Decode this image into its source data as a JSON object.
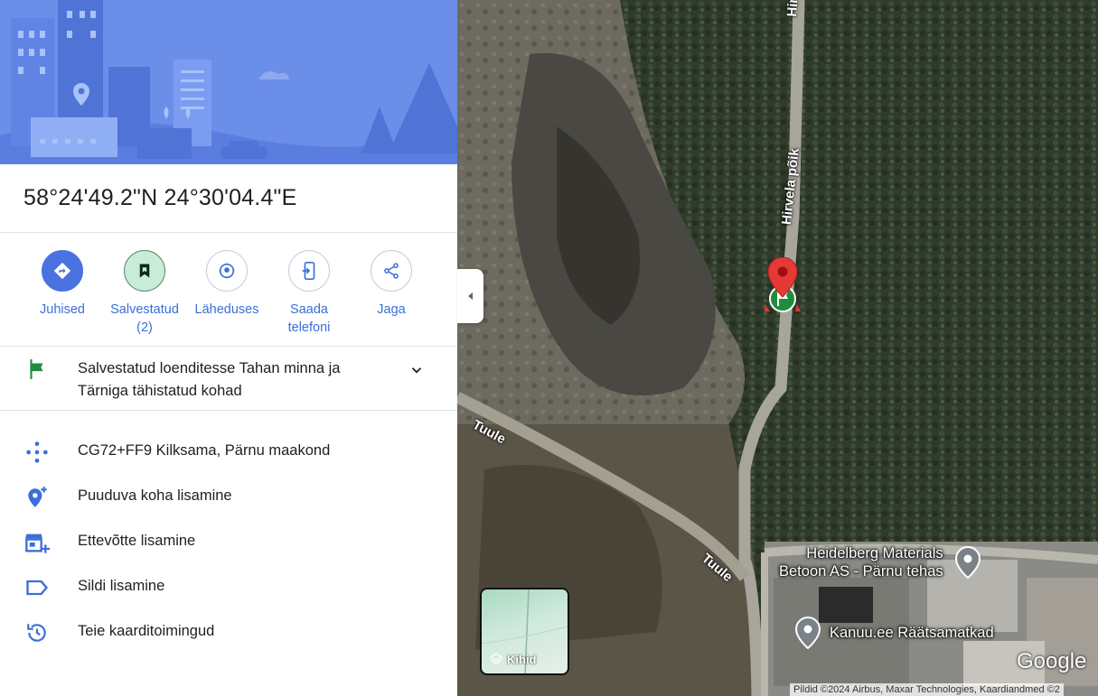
{
  "place": {
    "coordinates": "58°24'49.2\"N 24°30'04.4\"E"
  },
  "actions": [
    {
      "label": "Juhised",
      "icon": "directions-icon"
    },
    {
      "label": "Salvestatud (2)",
      "icon": "bookmark-icon"
    },
    {
      "label": "Läheduses",
      "icon": "nearby-icon"
    },
    {
      "label": "Saada telefoni",
      "icon": "send-to-phone-icon"
    },
    {
      "label": "Jaga",
      "icon": "share-icon"
    }
  ],
  "saved_lists": {
    "text": "Salvestatud loenditesse Tahan minna ja Tärniga tähistatud kohad",
    "icon": "flag-icon"
  },
  "details": [
    {
      "label": "CG72+FF9 Kilksama, Pärnu maakond",
      "icon": "plus-code-icon"
    },
    {
      "label": "Puuduva koha lisamine",
      "icon": "add-place-icon"
    },
    {
      "label": "Ettevõtte lisamine",
      "icon": "add-business-icon"
    },
    {
      "label": "Sildi lisamine",
      "icon": "label-icon"
    },
    {
      "label": "Teie kaarditoimingud",
      "icon": "history-icon"
    }
  ],
  "map": {
    "roads": [
      "Hirvela",
      "Hirvela põik",
      "Tuule",
      "Tuule"
    ],
    "pois": [
      {
        "name_line1": "Heidelberg Materials",
        "name_line2": "Betoon AS - Pärnu tehas"
      },
      {
        "name_line1": "Kanuu.ee Räätsamatkad"
      }
    ],
    "layers_label": "Kihid",
    "logo": "Google",
    "attribution": "Pildid ©2024 Airbus, Maxar Technologies, Kaardiandmed ©2",
    "colors": {
      "forest": "#2f3b2c",
      "pin": "#e53935",
      "accent": "#4a72e0"
    }
  }
}
